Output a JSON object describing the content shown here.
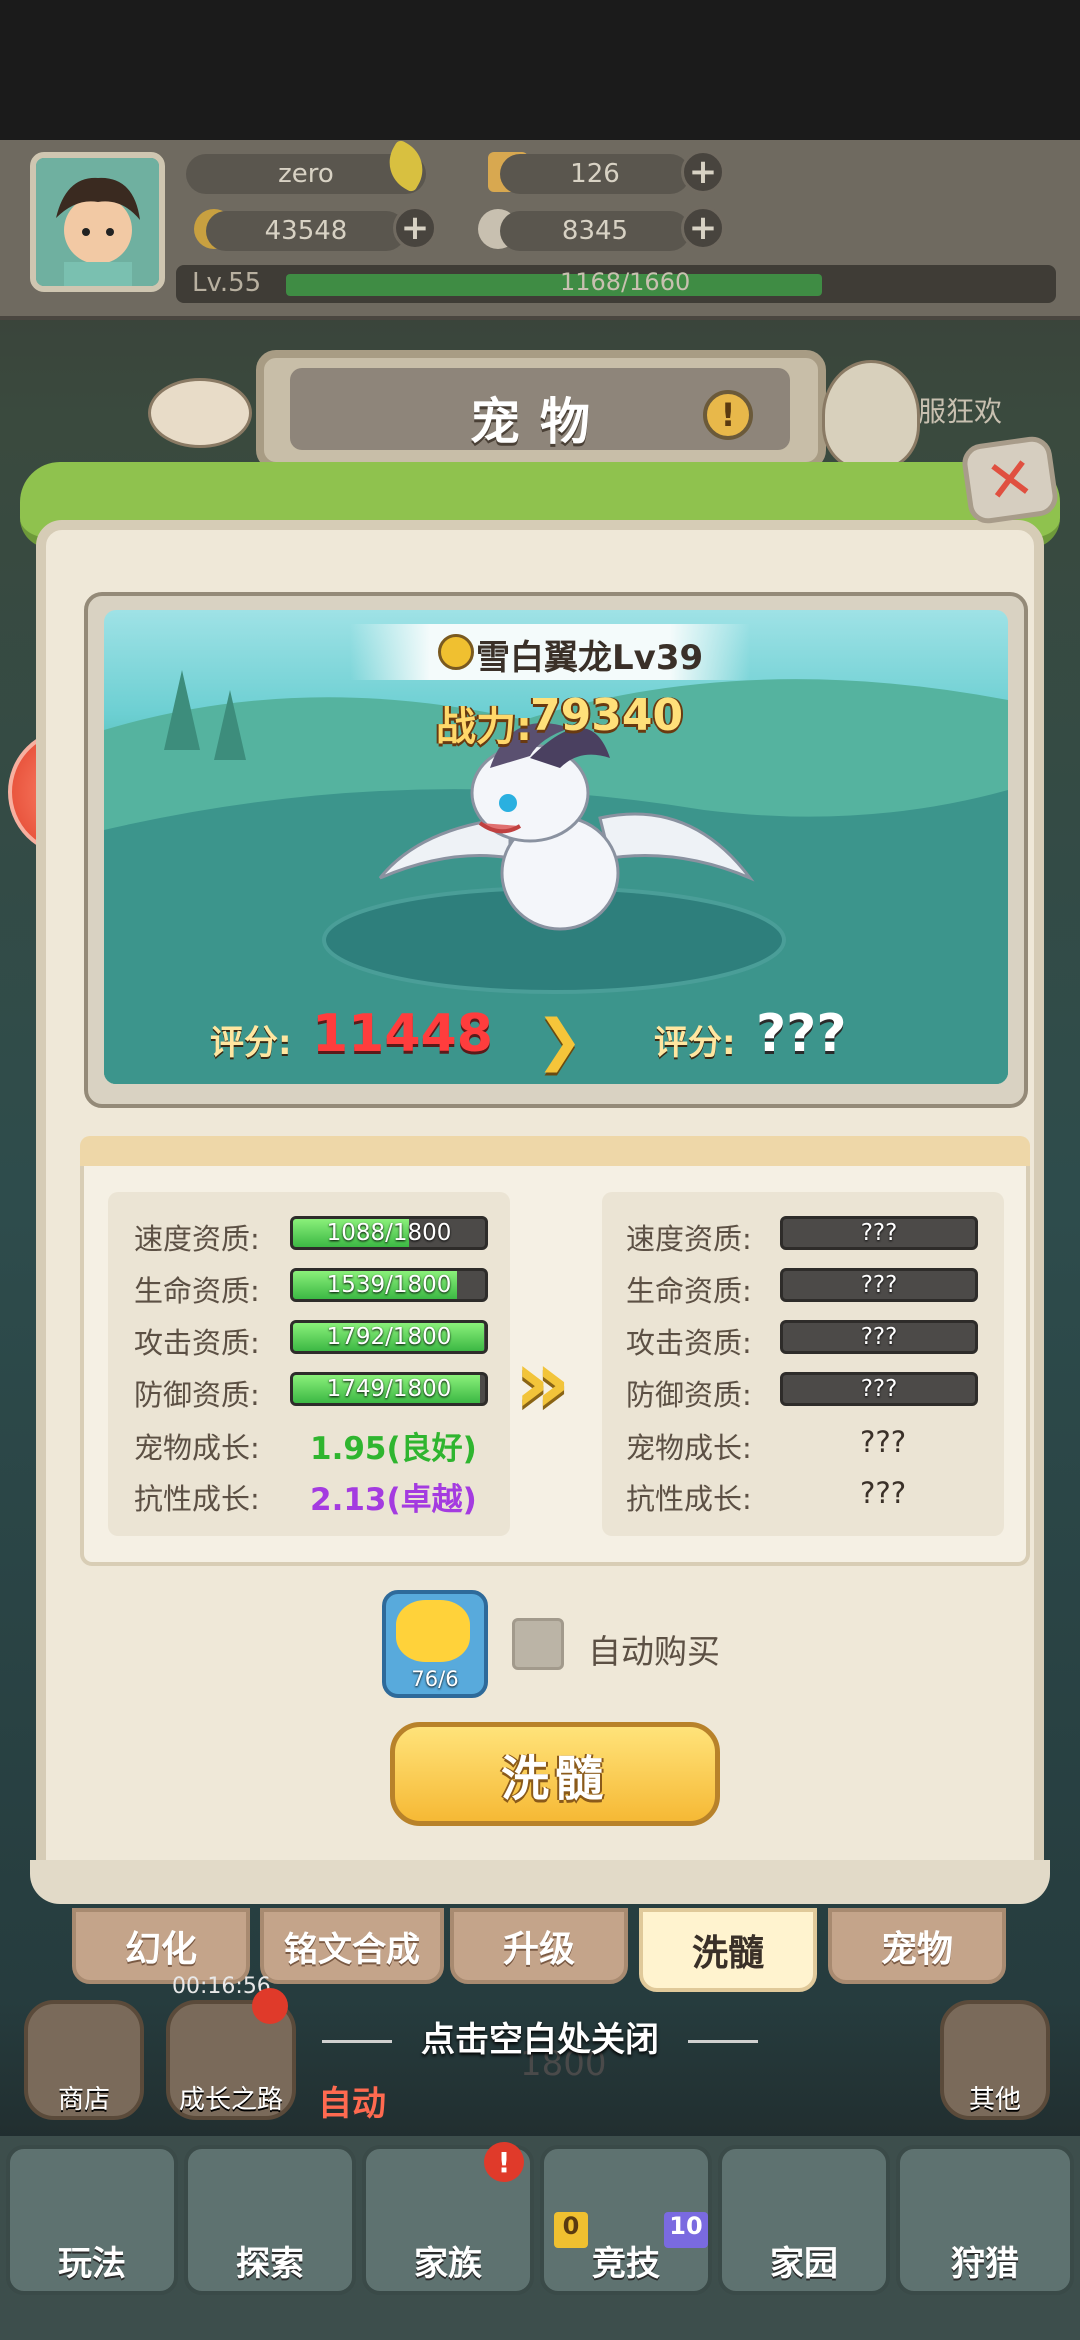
{
  "hud": {
    "player_name": "zero",
    "tickets": "126",
    "gold": "43548",
    "shells": "8345",
    "level": "Lv.55",
    "exp": "1168/1660",
    "exp_fraction": 0.704
  },
  "behind": {
    "event_label": "新服狂欢",
    "timer": "00:16:56",
    "shop": "商店",
    "growth_road": "成长之路",
    "auto": "自动",
    "score": "1800",
    "other": "其他"
  },
  "modal": {
    "title": "宠物",
    "help_icon": "!",
    "close_icon": "✕"
  },
  "pet": {
    "name": "雪白翼龙Lv39",
    "power_label": "战力:",
    "power_value": "79340",
    "score_label": "评分:",
    "score_current": "11448",
    "score_next": "???",
    "arrow": "❯"
  },
  "stats": {
    "current": [
      {
        "label": "速度资质:",
        "value": "1088/1800",
        "fraction": 0.604
      },
      {
        "label": "生命资质:",
        "value": "1539/1800",
        "fraction": 0.855
      },
      {
        "label": "攻击资质:",
        "value": "1792/1800",
        "fraction": 0.996
      },
      {
        "label": "防御资质:",
        "value": "1749/1800",
        "fraction": 0.972
      }
    ],
    "current_growth": [
      {
        "label": "宠物成长:",
        "value": "1.95(良好)",
        "color": "#2fb52f"
      },
      {
        "label": "抗性成长:",
        "value": "2.13(卓越)",
        "color": "#a43be0"
      }
    ],
    "next": [
      {
        "label": "速度资质:",
        "value": "???"
      },
      {
        "label": "生命资质:",
        "value": "???"
      },
      {
        "label": "攻击资质:",
        "value": "???"
      },
      {
        "label": "防御资质:",
        "value": "???"
      }
    ],
    "next_growth": [
      {
        "label": "宠物成长:",
        "value": "???"
      },
      {
        "label": "抗性成长:",
        "value": "???"
      }
    ]
  },
  "item": {
    "count": "76/6",
    "auto_buy_label": "自动购买",
    "auto_buy_checked": false
  },
  "wash_button": "洗髓",
  "tabs": [
    {
      "label": "幻化",
      "active": false
    },
    {
      "label": "铭文合成",
      "active": false
    },
    {
      "label": "升级",
      "active": false
    },
    {
      "label": "洗髓",
      "active": true
    },
    {
      "label": "宠物",
      "active": false
    }
  ],
  "close_hint": "点击空白处关闭",
  "bottom_nav": [
    {
      "label": "玩法",
      "badge": false
    },
    {
      "label": "探索",
      "badge": false
    },
    {
      "label": "家族",
      "badge": true
    },
    {
      "label": "竞技",
      "badge": false
    },
    {
      "label": "家园",
      "badge": false
    },
    {
      "label": "狩猎",
      "badge": false
    }
  ],
  "nav_badges": {
    "arena_left": "0",
    "arena_right": "10"
  },
  "colors": {
    "accent_gold": "#f6b935",
    "red": "#ff3d3d",
    "green_bar": "#3cb844"
  }
}
